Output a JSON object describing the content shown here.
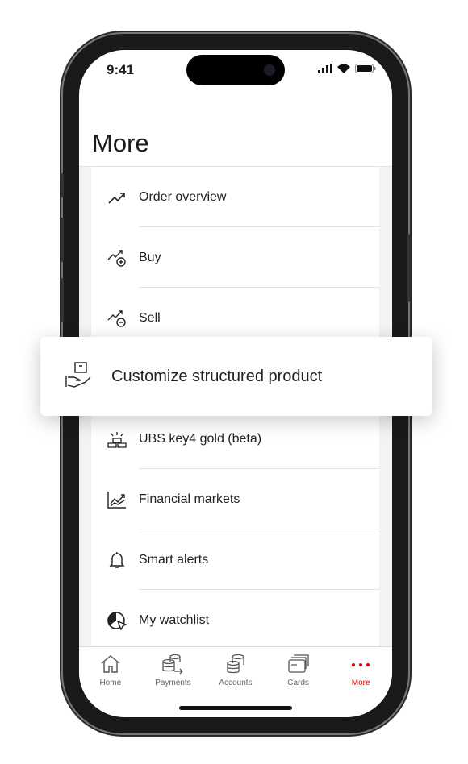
{
  "status_bar": {
    "time": "9:41"
  },
  "page_title": "More",
  "menu": [
    {
      "label": "Order overview",
      "icon": "trend-up-icon"
    },
    {
      "label": "Buy",
      "icon": "trend-plus-icon"
    },
    {
      "label": "Sell",
      "icon": "trend-minus-icon"
    },
    {
      "label": "Customize structured product",
      "icon": "hand-box-icon"
    },
    {
      "label": "UBS key4 gold (beta)",
      "icon": "gold-bars-icon"
    },
    {
      "label": "Financial markets",
      "icon": "chart-icon"
    },
    {
      "label": "Smart alerts",
      "icon": "bell-icon"
    },
    {
      "label": "My watchlist",
      "icon": "watchlist-icon"
    }
  ],
  "tabs": [
    {
      "label": "Home",
      "icon": "home-icon"
    },
    {
      "label": "Payments",
      "icon": "payments-icon"
    },
    {
      "label": "Accounts",
      "icon": "coins-icon"
    },
    {
      "label": "Cards",
      "icon": "cards-icon"
    },
    {
      "label": "More",
      "icon": "dots-icon",
      "active": true
    }
  ],
  "colors": {
    "accent": "#e60000"
  }
}
